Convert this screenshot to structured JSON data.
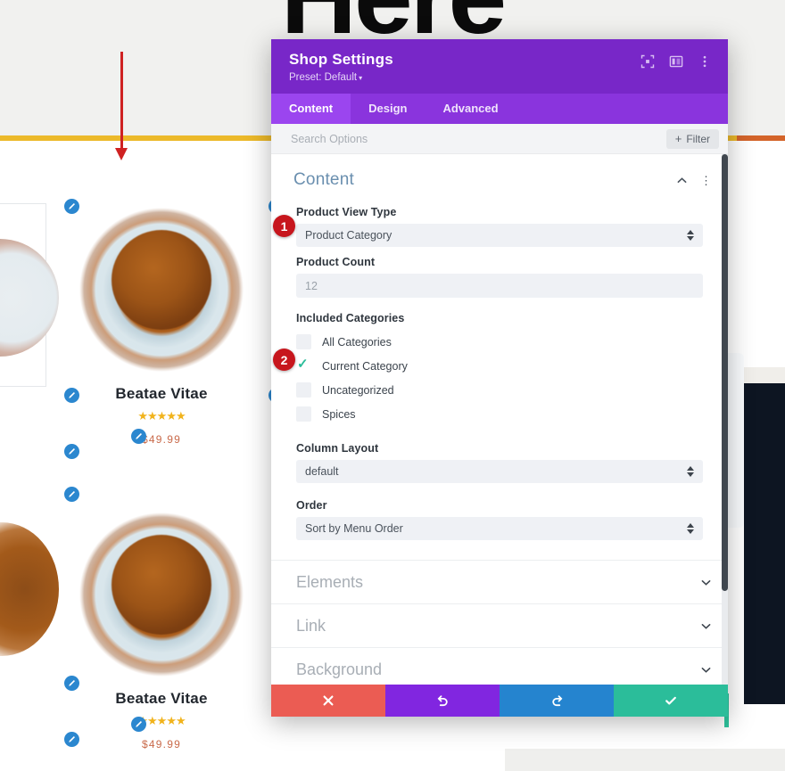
{
  "page": {
    "hero_title": "Here",
    "products": [
      {
        "name": "Beatae Vitae",
        "stars": "★★★★★",
        "price": "$49.99"
      },
      {
        "name": "Beatae Vitae",
        "stars": "★★★★★",
        "price": "$49.99"
      }
    ],
    "colors": {
      "rule_yellow": "#ecb92a",
      "rule_orange": "#d4642a",
      "arrow_red": "#cf2222",
      "edit_pencil_blue": "#2b87cf",
      "dark_section": "#0d1522"
    }
  },
  "modal": {
    "title": "Shop Settings",
    "preset": "Preset: Default",
    "preset_caret": "▾",
    "header_icons": [
      {
        "name": "focus-icon"
      },
      {
        "name": "layout-columns-icon"
      },
      {
        "name": "kebab-menu-icon"
      }
    ],
    "tabs": [
      {
        "label": "Content",
        "active": true
      },
      {
        "label": "Design",
        "active": false
      },
      {
        "label": "Advanced",
        "active": false
      }
    ],
    "search": {
      "placeholder": "Search Options",
      "value": ""
    },
    "filter_button": {
      "plus": "+",
      "label": "Filter"
    },
    "section": {
      "title": "Content",
      "kebab": "⋮"
    },
    "fields": {
      "product_view_type": {
        "label": "Product View Type",
        "value": "Product Category"
      },
      "product_count": {
        "label": "Product Count",
        "value": "12"
      },
      "included_categories": {
        "label": "Included Categories",
        "options": [
          {
            "label": "All Categories",
            "checked": false
          },
          {
            "label": "Current Category",
            "checked": true
          },
          {
            "label": "Uncategorized",
            "checked": false
          },
          {
            "label": "Spices",
            "checked": false
          }
        ]
      },
      "column_layout": {
        "label": "Column Layout",
        "value": "default"
      },
      "order": {
        "label": "Order",
        "value": "Sort by Menu Order"
      }
    },
    "accordions": [
      {
        "label": "Elements"
      },
      {
        "label": "Link"
      },
      {
        "label": "Background"
      }
    ],
    "footer_buttons": [
      {
        "name": "cancel-button",
        "icon": "x-icon",
        "color": "#eb5c53"
      },
      {
        "name": "undo-button",
        "icon": "undo-icon",
        "color": "#8126e0"
      },
      {
        "name": "redo-button",
        "icon": "redo-icon",
        "color": "#2584cf"
      },
      {
        "name": "save-button",
        "icon": "check-icon",
        "color": "#2bbd9a"
      }
    ]
  },
  "annotations": {
    "badge_1": "1",
    "badge_2": "2"
  }
}
